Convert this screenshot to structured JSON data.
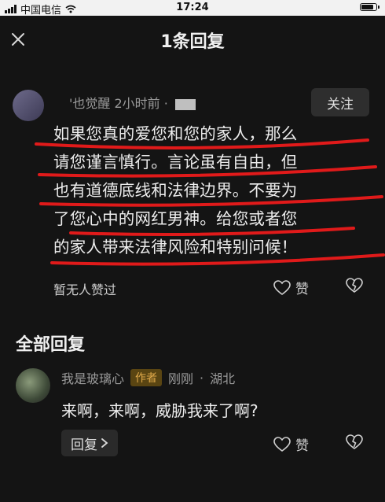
{
  "status_bar": {
    "carrier": "中国电信",
    "time": "17:24"
  },
  "header": {
    "title": "1条回复"
  },
  "post": {
    "author": "'也觉醒",
    "time": "2小时前 · ",
    "follow_label": "关注",
    "lines": [
      "如果您真的爱您和您的家人，那么",
      "请您谨言慎行。言论虽有自由，但",
      "也有道德底线和法律边界。不要为",
      "了您心中的网红男神。给您或者您",
      "的家人带来法律风险和特别问候！"
    ],
    "likes_text": "暂无人赞过",
    "like_label": "赞"
  },
  "section_title": "全部回复",
  "reply": {
    "author": "我是玻璃心",
    "badge": "作者",
    "time": "刚刚",
    "location": "湖北",
    "text": "来啊，来啊，威胁我来了啊?",
    "reply_label": "回复",
    "like_label": "赞"
  },
  "colors": {
    "background": "#141414",
    "scribble": "#e01a1a",
    "badge": "#e0a94a"
  }
}
